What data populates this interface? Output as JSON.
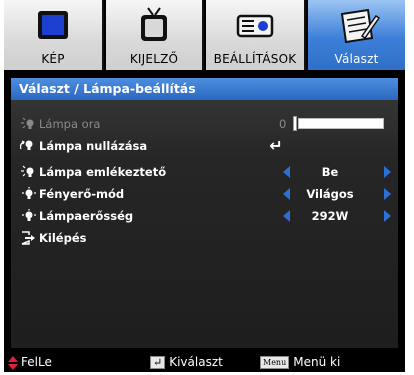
{
  "tabs": [
    {
      "label": "KÉP",
      "icon": "picture-icon",
      "active": false
    },
    {
      "label": "KIJELZŐ",
      "icon": "display-tv-icon",
      "active": false
    },
    {
      "label": "BEÁLLÍTÁSOK",
      "icon": "settings-projector-icon",
      "active": false
    },
    {
      "label": "Választ",
      "icon": "options-notepad-icon",
      "active": true
    }
  ],
  "panel": {
    "title": "Választ / Lámpa-beállítás",
    "rows": [
      {
        "label": "Lámpa ora",
        "icon": "lamp-bulb-icon",
        "dim": true,
        "value": "0",
        "type": "slider",
        "slider_fraction": 0
      },
      {
        "label": "Lámpa nullázása",
        "icon": "lamp-reset-icon",
        "dim": false,
        "value": "↵",
        "type": "enter"
      },
      {
        "label": "Lámpa emlékeztető",
        "icon": "lamp-bulb-icon",
        "dim": false,
        "value": "Be",
        "type": "select"
      },
      {
        "label": "Fényerő-mód",
        "icon": "bulb-icon",
        "dim": false,
        "value": "Világos",
        "type": "select"
      },
      {
        "label": "Lámpaerősség",
        "icon": "bulb-icon",
        "dim": false,
        "value": "292W",
        "type": "select"
      },
      {
        "label": "Kilépés",
        "icon": "exit-icon",
        "dim": false,
        "value": "",
        "type": "exit"
      }
    ]
  },
  "footer": {
    "nav_label": "FelLe",
    "select_label": "Kiválaszt",
    "menu_key": "Menu",
    "menu_label": "Menü ki"
  },
  "colors": {
    "accent": "#2c6fd6",
    "title_bar": "#3a79d4",
    "footer_arrow": "#e0203a"
  }
}
